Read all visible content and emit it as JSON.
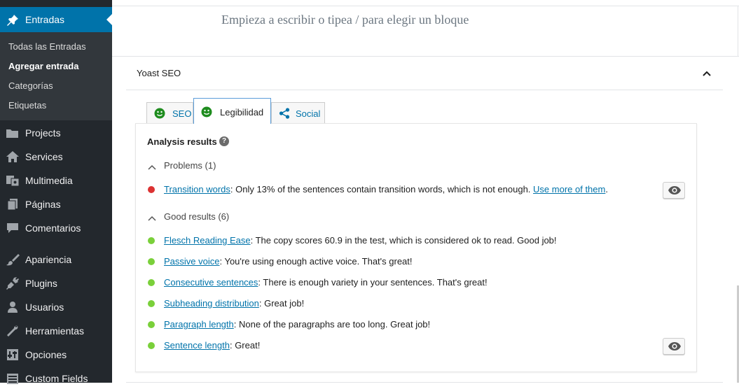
{
  "sidebar": {
    "active": {
      "label": "Entradas",
      "icon": "pin-icon"
    },
    "submenu": [
      {
        "label": "Todas las Entradas",
        "current": false
      },
      {
        "label": "Agregar entrada",
        "current": true
      },
      {
        "label": "Categorías",
        "current": false
      },
      {
        "label": "Etiquetas",
        "current": false
      }
    ],
    "items": [
      {
        "label": "Projects",
        "icon": "folder-icon"
      },
      {
        "label": "Services",
        "icon": "home-icon"
      },
      {
        "label": "Multimedia",
        "icon": "media-icon"
      },
      {
        "label": "Páginas",
        "icon": "pages-icon"
      },
      {
        "label": "Comentarios",
        "icon": "comments-icon"
      },
      {
        "label": "Apariencia",
        "icon": "brush-icon"
      },
      {
        "label": "Plugins",
        "icon": "plugin-icon"
      },
      {
        "label": "Usuarios",
        "icon": "user-icon"
      },
      {
        "label": "Herramientas",
        "icon": "wrench-icon"
      },
      {
        "label": "Opciones",
        "icon": "settings-icon"
      },
      {
        "label": "Custom Fields",
        "icon": "fields-icon"
      }
    ]
  },
  "editor": {
    "placeholder": "Empieza a escribir o tipea / para elegir un bloque"
  },
  "yoast": {
    "title": "Yoast SEO",
    "tabs": [
      {
        "label": "SEO",
        "icon": "smiley-icon",
        "active": false
      },
      {
        "label": "Legibilidad",
        "icon": "smiley-icon",
        "active": true
      },
      {
        "label": "Social",
        "icon": "share-icon",
        "active": false
      }
    ],
    "analysis_title": "Analysis results",
    "help_glyph": "?",
    "problems": {
      "label": "Problems (1)",
      "items": [
        {
          "link": "Transition words",
          "text": ": Only 13% of the sentences contain transition words, which is not enough. ",
          "link2": "Use more of them",
          "tail": "."
        }
      ]
    },
    "good": {
      "label": "Good results (6)",
      "items": [
        {
          "link": "Flesch Reading Ease",
          "text": ": The copy scores 60.9 in the test, which is considered ok to read. Good job!"
        },
        {
          "link": "Passive voice",
          "text": ": You're using enough active voice. That's great!"
        },
        {
          "link": "Consecutive sentences",
          "text": ": There is enough variety in your sentences. That's great!"
        },
        {
          "link": "Subheading distribution",
          "text": ": Great job!"
        },
        {
          "link": "Paragraph length",
          "text": ": None of the paragraphs are too long. Great job!"
        },
        {
          "link": "Sentence length",
          "text": ": Great!"
        }
      ]
    },
    "colors": {
      "bad": "#dc3232",
      "good": "#7ad03a",
      "smiley": "#1e8c1e",
      "link": "#0073aa"
    }
  }
}
